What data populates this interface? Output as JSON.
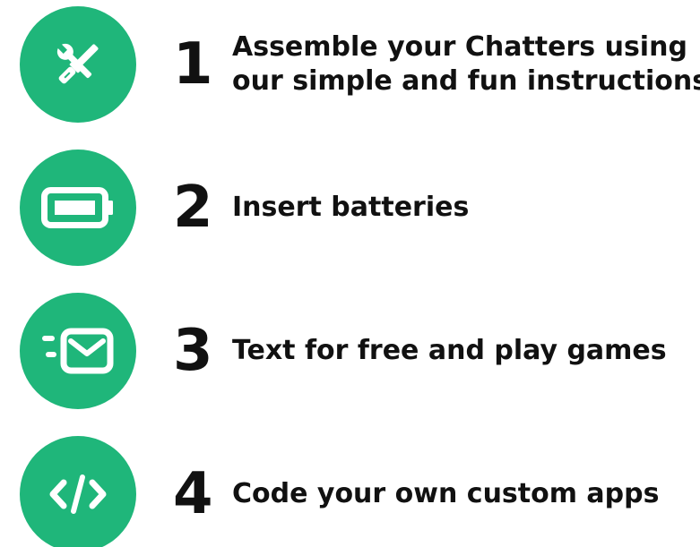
{
  "colors": {
    "accent": "#1fb67a",
    "text": "#111111",
    "icon": "#ffffff"
  },
  "steps": [
    {
      "number": "1",
      "icon": "tools-icon",
      "label_line1": "Assemble your Chatters using",
      "label_line2": "our simple and fun instructions"
    },
    {
      "number": "2",
      "icon": "battery-icon",
      "label_line1": "Insert batteries"
    },
    {
      "number": "3",
      "icon": "message-icon",
      "label_line1": "Text for free and play games"
    },
    {
      "number": "4",
      "icon": "code-icon",
      "label_line1": "Code your own custom apps"
    }
  ]
}
